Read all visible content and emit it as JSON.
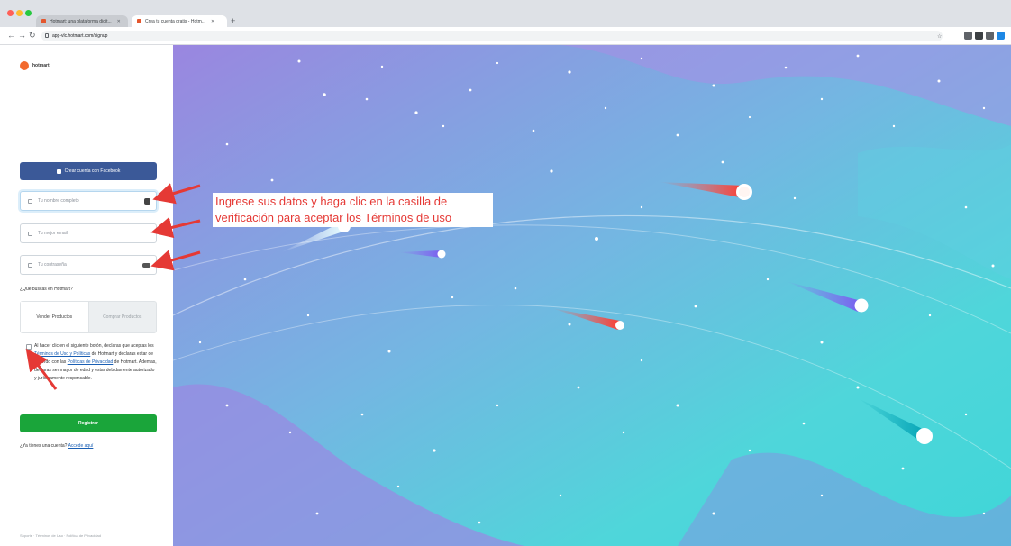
{
  "browser": {
    "tabs": [
      {
        "label": "Hotmart: una plataforma digit..."
      },
      {
        "label": "Crea tu cuenta gratis - Hotm..."
      }
    ],
    "new_tab": "+",
    "address": "app-vlc.hotmart.com/signup",
    "traffic_colors": [
      "#ff5f57",
      "#febc2e",
      "#28c840"
    ]
  },
  "left": {
    "logo_text": "hotmart",
    "facebook_button": "Crear cuenta con Facebook",
    "fields": {
      "name_placeholder": "Tu nombre completo",
      "email_placeholder": "Tu mejor email",
      "password_placeholder": "Tu contraseña"
    },
    "question": "¿Qué buscas en Hotmart?",
    "options": {
      "sell": "Vender Productos",
      "buy": "Comprar Productos"
    },
    "terms": {
      "pre": "Al hacer clic en el siguiente botón, declaras que aceptas los ",
      "link1": "Términos de Uso y Políticas",
      "mid": " de Hotmart y declaras estar de acuerdo con las ",
      "link2": "Políticas de Privacidad",
      "post": " de Hotmart. Ademas, declaras ser mayor de edad y estar debidamente autorizado y jurídicamente responsable."
    },
    "register_button": "Registrar",
    "have_account": "¿Ya tienes una cuenta? ",
    "login_link": "Accede aquí",
    "footer": "Soporte · Términos de Uso · Política de Privacidad"
  },
  "annotation": {
    "line1": "Ingrese sus datos y haga clic en la casilla de",
    "line2": "verificación para aceptar los Términos de uso"
  },
  "colors": {
    "accent_red": "#e53935",
    "facebook": "#3b5998",
    "register_green": "#1aa53a",
    "sky_purple": "#9a86e0",
    "sky_teal": "#3fd6d8"
  }
}
